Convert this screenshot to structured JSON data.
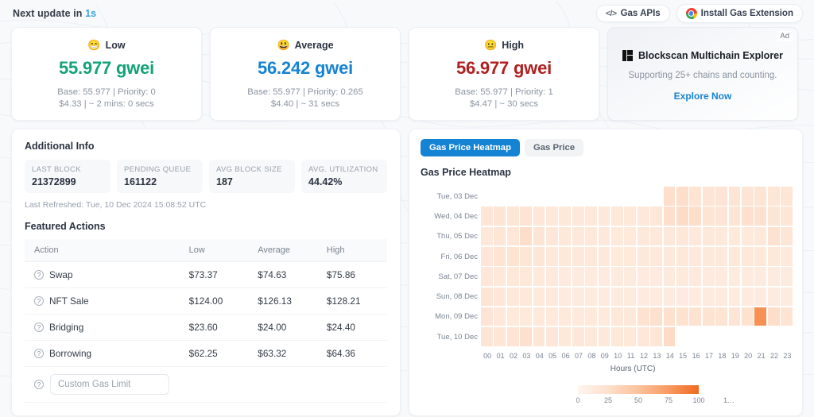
{
  "header": {
    "next_update_prefix": "Next update in",
    "next_update_value": "1s",
    "gas_apis_label": "Gas APIs",
    "gas_apis_icon": "code-brackets-icon",
    "extension_label": "Install Gas Extension",
    "extension_icon": "chrome-icon"
  },
  "tiers": [
    {
      "name": "Low",
      "emoji": "😁",
      "value": "55.977 gwei",
      "color": "#12a378",
      "detail1": "Base: 55.977 | Priority: 0",
      "detail2": "$4.33 | ~ 2 mins: 0 secs"
    },
    {
      "name": "Average",
      "emoji": "😃",
      "value": "56.242 gwei",
      "color": "#1583d4",
      "detail1": "Base: 55.977 | Priority: 0.265",
      "detail2": "$4.40 | ~ 31 secs"
    },
    {
      "name": "High",
      "emoji": "😐",
      "value": "56.977 gwei",
      "color": "#b02020",
      "detail1": "Base: 55.977 | Priority: 1",
      "detail2": "$4.47 | ~ 30 secs"
    }
  ],
  "ad": {
    "badge": "Ad",
    "logo_icon": "blockscan-logo-icon",
    "title": "Blockscan Multichain Explorer",
    "subtitle": "Supporting 25+ chains and counting.",
    "cta": "Explore Now"
  },
  "additional_info": {
    "title": "Additional Info",
    "stats": [
      {
        "label": "LAST BLOCK",
        "value": "21372899"
      },
      {
        "label": "PENDING QUEUE",
        "value": "161122"
      },
      {
        "label": "AVG BLOCK SIZE",
        "value": "187"
      },
      {
        "label": "AVG. UTILIZATION",
        "value": "44.42%"
      }
    ],
    "last_refreshed": "Last Refreshed: Tue, 10 Dec 2024 15:08:52 UTC"
  },
  "featured_actions": {
    "title": "Featured Actions",
    "columns": [
      "Action",
      "Low",
      "Average",
      "High"
    ],
    "rows": [
      {
        "action": "Swap",
        "low": "$73.37",
        "average": "$74.63",
        "high": "$75.86"
      },
      {
        "action": "NFT Sale",
        "low": "$124.00",
        "average": "$126.13",
        "high": "$128.21"
      },
      {
        "action": "Bridging",
        "low": "$23.60",
        "average": "$24.00",
        "high": "$24.40"
      },
      {
        "action": "Borrowing",
        "low": "$62.25",
        "average": "$63.32",
        "high": "$64.36"
      }
    ],
    "custom_limit_placeholder": "Custom Gas Limit",
    "custom_limit_value": ""
  },
  "chart_panel": {
    "tabs": [
      {
        "label": "Gas Price Heatmap",
        "active": true
      },
      {
        "label": "Gas Price",
        "active": false
      }
    ]
  },
  "chart_data": {
    "type": "heatmap",
    "title": "Gas Price Heatmap",
    "xlabel": "Hours (UTC)",
    "ylabel": "",
    "x": [
      "00",
      "01",
      "02",
      "03",
      "04",
      "05",
      "06",
      "07",
      "08",
      "09",
      "10",
      "11",
      "12",
      "13",
      "14",
      "15",
      "16",
      "17",
      "18",
      "19",
      "20",
      "21",
      "22",
      "23"
    ],
    "y": [
      "Tue, 03 Dec",
      "Wed, 04 Dec",
      "Thu, 05 Dec",
      "Fri, 06 Dec",
      "Sat, 07 Dec",
      "Sun, 08 Dec",
      "Mon, 09 Dec",
      "Tue, 10 Dec"
    ],
    "legend": {
      "ticks": [
        "0",
        "25",
        "50",
        "75",
        "100",
        "1…"
      ],
      "min": 0,
      "max": 125,
      "colors": [
        "#fff5ef",
        "#fde0cd",
        "#fbc19b",
        "#f89a62",
        "#ef6a1f"
      ]
    },
    "values": [
      [
        null,
        null,
        null,
        null,
        null,
        null,
        null,
        null,
        null,
        null,
        null,
        null,
        null,
        null,
        32,
        33,
        26,
        25,
        25,
        25,
        24,
        24,
        23,
        22
      ],
      [
        22,
        24,
        23,
        25,
        21,
        20,
        19,
        19,
        20,
        20,
        20,
        19,
        20,
        21,
        32,
        35,
        33,
        26,
        25,
        24,
        30,
        30,
        24,
        22
      ],
      [
        20,
        22,
        21,
        33,
        24,
        21,
        20,
        20,
        19,
        19,
        18,
        18,
        19,
        19,
        20,
        21,
        20,
        19,
        19,
        18,
        18,
        20,
        28,
        22
      ],
      [
        21,
        26,
        27,
        23,
        22,
        20,
        19,
        19,
        19,
        19,
        18,
        18,
        19,
        19,
        20,
        20,
        20,
        19,
        19,
        19,
        20,
        20,
        19,
        18
      ],
      [
        21,
        20,
        19,
        19,
        18,
        17,
        16,
        16,
        16,
        16,
        15,
        15,
        16,
        16,
        17,
        17,
        17,
        16,
        16,
        15,
        15,
        15,
        15,
        15
      ],
      [
        26,
        21,
        19,
        19,
        18,
        17,
        16,
        16,
        16,
        16,
        15,
        15,
        16,
        16,
        16,
        16,
        16,
        15,
        15,
        15,
        15,
        15,
        15,
        15
      ],
      [
        25,
        19,
        18,
        18,
        18,
        18,
        18,
        18,
        18,
        18,
        19,
        20,
        29,
        30,
        30,
        29,
        28,
        27,
        26,
        25,
        29,
        100,
        33,
        26
      ],
      [
        24,
        22,
        25,
        31,
        23,
        21,
        20,
        21,
        20,
        20,
        20,
        19,
        21,
        22,
        36,
        null,
        null,
        null,
        null,
        null,
        null,
        null,
        null,
        null
      ]
    ]
  }
}
